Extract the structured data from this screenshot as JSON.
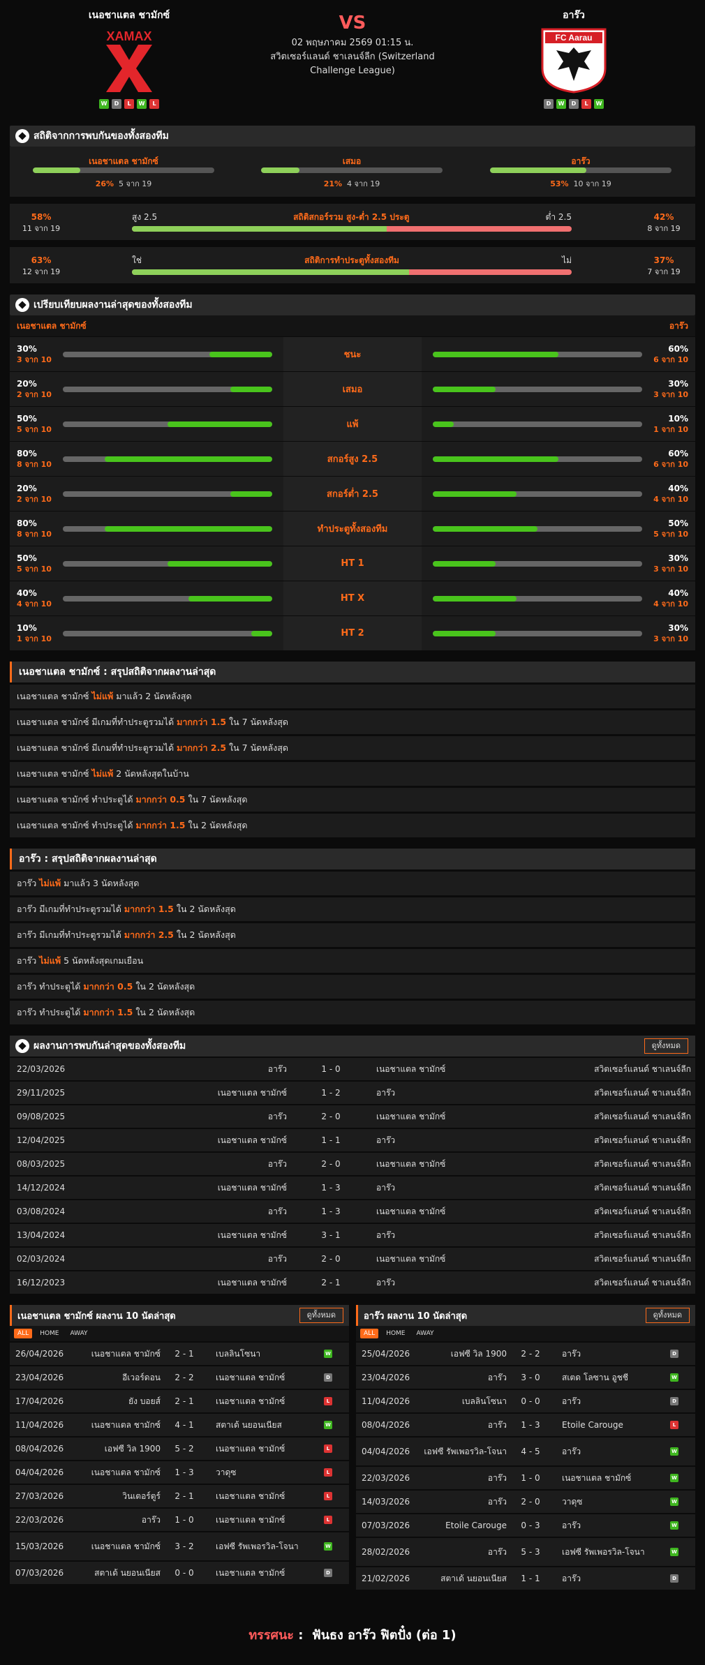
{
  "home": {
    "name": "เนอชาแตล ชามักซ์",
    "form": [
      "W",
      "D",
      "L",
      "W",
      "L"
    ],
    "logo_text": "XAMAX"
  },
  "away": {
    "name": "อาร๊ว",
    "form": [
      "D",
      "W",
      "D",
      "L",
      "W"
    ],
    "logo_text": "FC Aarau"
  },
  "match": {
    "vs": "VS",
    "date": "02 พฤษภาคม 2569 01:15 น.",
    "league": "สวิตเซอร์แลนด์ ชาเลนจ์ลีก (Switzerland Challenge League)"
  },
  "colors": {
    "accent": "#ff6b1a",
    "win": "#3fb620",
    "lose": "#d33333",
    "draw": "#777777",
    "bar_green": "#8ed05a",
    "bar_red": "#f07070"
  },
  "h2h_title": "สถิติจากการพบกันของทั้งสองทีม",
  "h2h": [
    {
      "label": "เนอชาแตล ชามักซ์",
      "pct": "26%",
      "detail": "5 จาก 19",
      "fill": 0.26
    },
    {
      "label": "เสมอ",
      "pct": "21%",
      "detail": "4 จาก 19",
      "fill": 0.21
    },
    {
      "label": "อาร๊ว",
      "pct": "53%",
      "detail": "10 จาก 19",
      "fill": 0.53
    }
  ],
  "ou": {
    "left_pct": "58%",
    "left_detail": "11 จาก 19",
    "right_pct": "42%",
    "right_detail": "8 จาก 19",
    "over": "สูง 2.5",
    "under": "ต่ำ 2.5",
    "title": "สถิติสกอร์รวม สูง-ต่ำ 2.5 ประตู",
    "fill": 0.58
  },
  "btts": {
    "left_pct": "63%",
    "left_detail": "12 จาก 19",
    "right_pct": "37%",
    "right_detail": "7 จาก 19",
    "yes": "ใช่",
    "no": "ไม่",
    "title": "สถิติการทำประตูทั้งสองทีม",
    "fill": 0.63
  },
  "compare_title": "เปรียบเทียบผลงานล่าสุดของทั้งสองทีม",
  "compare": [
    {
      "label": "ชนะ",
      "hp": "30%",
      "hd": "3 จาก 10",
      "hf": 0.3,
      "ap": "60%",
      "ad": "6 จาก 10",
      "af": 0.6
    },
    {
      "label": "เสมอ",
      "hp": "20%",
      "hd": "2 จาก 10",
      "hf": 0.2,
      "ap": "30%",
      "ad": "3 จาก 10",
      "af": 0.3
    },
    {
      "label": "แพ้",
      "hp": "50%",
      "hd": "5 จาก 10",
      "hf": 0.5,
      "ap": "10%",
      "ad": "1 จาก 10",
      "af": 0.1
    },
    {
      "label": "สกอร์สูง 2.5",
      "hp": "80%",
      "hd": "8 จาก 10",
      "hf": 0.8,
      "ap": "60%",
      "ad": "6 จาก 10",
      "af": 0.6
    },
    {
      "label": "สกอร์ต่ำ 2.5",
      "hp": "20%",
      "hd": "2 จาก 10",
      "hf": 0.2,
      "ap": "40%",
      "ad": "4 จาก 10",
      "af": 0.4
    },
    {
      "label": "ทำประตูทั้งสองทีม",
      "hp": "80%",
      "hd": "8 จาก 10",
      "hf": 0.8,
      "ap": "50%",
      "ad": "5 จาก 10",
      "af": 0.5
    },
    {
      "label": "HT 1",
      "hp": "50%",
      "hd": "5 จาก 10",
      "hf": 0.5,
      "ap": "30%",
      "ad": "3 จาก 10",
      "af": 0.3
    },
    {
      "label": "HT X",
      "hp": "40%",
      "hd": "4 จาก 10",
      "hf": 0.4,
      "ap": "40%",
      "ad": "4 จาก 10",
      "af": 0.4
    },
    {
      "label": "HT 2",
      "hp": "10%",
      "hd": "1 จาก 10",
      "hf": 0.1,
      "ap": "30%",
      "ad": "3 จาก 10",
      "af": 0.3
    }
  ],
  "home_summary_title": "เนอชาแตล ชามักซ์ : สรุปสถิติจากผลงานล่าสุด",
  "home_summary": [
    [
      "เนอชาแตล ชามักซ์",
      "ไม่แพ้",
      "มาแล้ว 2 นัดหลังสุด"
    ],
    [
      "เนอชาแตล ชามักซ์ มีเกมที่ทำประตูรวมได้",
      "มากกว่า 1.5",
      "ใน 7 นัดหลังสุด"
    ],
    [
      "เนอชาแตล ชามักซ์ มีเกมที่ทำประตูรวมได้",
      "มากกว่า 2.5",
      "ใน 7 นัดหลังสุด"
    ],
    [
      "เนอชาแตล ชามักซ์",
      "ไม่แพ้",
      "2 นัดหลังสุดในบ้าน"
    ],
    [
      "เนอชาแตล ชามักซ์ ทำประตูได้",
      "มากกว่า 0.5",
      "ใน 7 นัดหลังสุด"
    ],
    [
      "เนอชาแตล ชามักซ์ ทำประตูได้",
      "มากกว่า 1.5",
      "ใน 2 นัดหลังสุด"
    ]
  ],
  "away_summary_title": "อาร๊ว : สรุปสถิติจากผลงานล่าสุด",
  "away_summary": [
    [
      "อาร๊ว",
      "ไม่แพ้",
      "มาแล้ว 3 นัดหลังสุด"
    ],
    [
      "อาร๊ว มีเกมที่ทำประตูรวมได้",
      "มากกว่า 1.5",
      "ใน 2 นัดหลังสุด"
    ],
    [
      "อาร๊ว มีเกมที่ทำประตูรวมได้",
      "มากกว่า 2.5",
      "ใน 2 นัดหลังสุด"
    ],
    [
      "อาร๊ว",
      "ไม่แพ้",
      "5 นัดหลังสุดเกมเยือน"
    ],
    [
      "อาร๊ว ทำประตูได้",
      "มากกว่า 0.5",
      "ใน 2 นัดหลังสุด"
    ],
    [
      "อาร๊ว ทำประตูได้",
      "มากกว่า 1.5",
      "ใน 2 นัดหลังสุด"
    ]
  ],
  "results_title": "ผลงานการพบกันล่าสุดของทั้งสองทีม",
  "view_all": "ดูทั้งหมด",
  "results": [
    [
      "22/03/2026",
      "อาร๊ว",
      "1 - 0",
      "เนอชาแตล ชามักซ์",
      "สวิตเซอร์แลนด์ ชาเลนจ์ลีก"
    ],
    [
      "29/11/2025",
      "เนอชาแตล ชามักซ์",
      "1 - 2",
      "อาร๊ว",
      "สวิตเซอร์แลนด์ ชาเลนจ์ลีก"
    ],
    [
      "09/08/2025",
      "อาร๊ว",
      "2 - 0",
      "เนอชาแตล ชามักซ์",
      "สวิตเซอร์แลนด์ ชาเลนจ์ลีก"
    ],
    [
      "12/04/2025",
      "เนอชาแตล ชามักซ์",
      "1 - 1",
      "อาร๊ว",
      "สวิตเซอร์แลนด์ ชาเลนจ์ลีก"
    ],
    [
      "08/03/2025",
      "อาร๊ว",
      "2 - 0",
      "เนอชาแตล ชามักซ์",
      "สวิตเซอร์แลนด์ ชาเลนจ์ลีก"
    ],
    [
      "14/12/2024",
      "เนอชาแตล ชามักซ์",
      "1 - 3",
      "อาร๊ว",
      "สวิตเซอร์แลนด์ ชาเลนจ์ลีก"
    ],
    [
      "03/08/2024",
      "อาร๊ว",
      "1 - 3",
      "เนอชาแตล ชามักซ์",
      "สวิตเซอร์แลนด์ ชาเลนจ์ลีก"
    ],
    [
      "13/04/2024",
      "เนอชาแตล ชามักซ์",
      "3 - 1",
      "อาร๊ว",
      "สวิตเซอร์แลนด์ ชาเลนจ์ลีก"
    ],
    [
      "02/03/2024",
      "อาร๊ว",
      "2 - 0",
      "เนอชาแตล ชามักซ์",
      "สวิตเซอร์แลนด์ ชาเลนจ์ลีก"
    ],
    [
      "16/12/2023",
      "เนอชาแตล ชามักซ์",
      "2 - 1",
      "อาร๊ว",
      "สวิตเซอร์แลนด์ ชาเลนจ์ลีก"
    ]
  ],
  "tabs": [
    "ALL",
    "HOME",
    "AWAY"
  ],
  "home_last_title": "เนอชาแตล ชามักซ์ ผลงาน 10 นัดล่าสุด",
  "home_last": [
    [
      "26/04/2026",
      "เนอชาแตล ชามักซ์",
      "2 - 1",
      "เบลลินโซนา",
      "W"
    ],
    [
      "23/04/2026",
      "อีเวอร์ดอน",
      "2 - 2",
      "เนอชาแตล ชามักซ์",
      "D"
    ],
    [
      "17/04/2026",
      "ยัง บอยส์",
      "2 - 1",
      "เนอชาแตล ชามักซ์",
      "L"
    ],
    [
      "11/04/2026",
      "เนอชาแตล ชามักซ์",
      "4 - 1",
      "สตาเด้ นยอนเนียส",
      "W"
    ],
    [
      "08/04/2026",
      "เอฟซี วิล 1900",
      "5 - 2",
      "เนอชาแตล ชามักซ์",
      "L"
    ],
    [
      "04/04/2026",
      "เนอชาแตล ชามักซ์",
      "1 - 3",
      "วาดุซ",
      "L"
    ],
    [
      "27/03/2026",
      "วินเตอร์ตูร์",
      "2 - 1",
      "เนอชาแตล ชามักซ์",
      "L"
    ],
    [
      "22/03/2026",
      "อาร๊ว",
      "1 - 0",
      "เนอชาแตล ชามักซ์",
      "L"
    ],
    [
      "15/03/2026",
      "เนอชาแตล ชามักซ์",
      "3 - 2",
      "เอฟซี รัพเพอรวิล-โจนา",
      "W"
    ],
    [
      "07/03/2026",
      "สตาเด้ นยอนเนียส",
      "0 - 0",
      "เนอชาแตล ชามักซ์",
      "D"
    ]
  ],
  "away_last_title": "อาร๊ว ผลงาน 10 นัดล่าสุด",
  "away_last": [
    [
      "25/04/2026",
      "เอฟซี วิล 1900",
      "2 - 2",
      "อาร๊ว",
      "D"
    ],
    [
      "23/04/2026",
      "อาร๊ว",
      "3 - 0",
      "สเตด โลซาน อูชชี",
      "W"
    ],
    [
      "11/04/2026",
      "เบลลินโซนา",
      "0 - 0",
      "อาร๊ว",
      "D"
    ],
    [
      "08/04/2026",
      "อาร๊ว",
      "1 - 3",
      "Etoile Carouge",
      "L"
    ],
    [
      "04/04/2026",
      "เอฟซี รัพเพอรวิล-โจนา",
      "4 - 5",
      "อาร๊ว",
      "W"
    ],
    [
      "22/03/2026",
      "อาร๊ว",
      "1 - 0",
      "เนอชาแตล ชามักซ์",
      "W"
    ],
    [
      "14/03/2026",
      "อาร๊ว",
      "2 - 0",
      "วาดุซ",
      "W"
    ],
    [
      "07/03/2026",
      "Etoile Carouge",
      "0 - 3",
      "อาร๊ว",
      "W"
    ],
    [
      "28/02/2026",
      "อาร๊ว",
      "5 - 3",
      "เอฟซี รัพเพอรวิล-โจนา",
      "W"
    ],
    [
      "21/02/2026",
      "สตาเด้ นยอนเนียส",
      "1 - 1",
      "อาร๊ว",
      "D"
    ]
  ],
  "prediction": {
    "label": "ทรรศนะ",
    "sep": ":",
    "text": "ฟันธง อาร๊ว ฟิตปั๋ง (ต่อ 1)"
  }
}
